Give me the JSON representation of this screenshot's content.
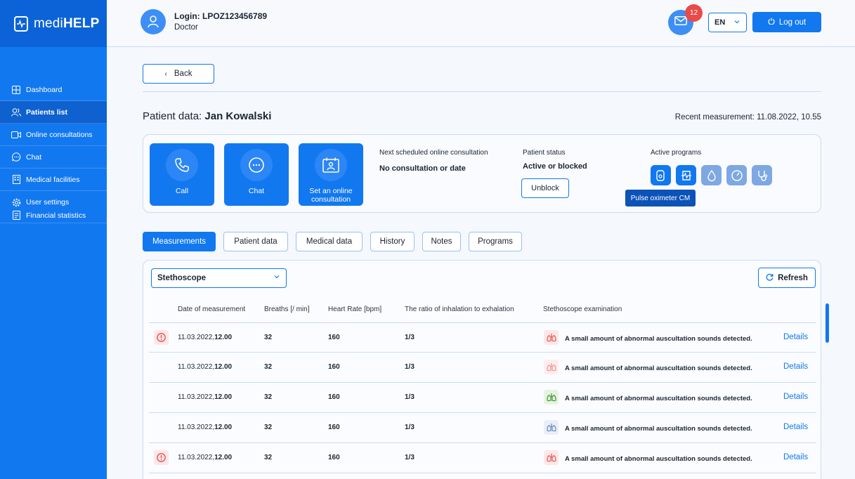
{
  "brand": {
    "name_prefix": "medi",
    "name_bold": "HELP"
  },
  "sidebar": {
    "items": [
      {
        "label": "Dashboard",
        "icon": "dashboard-icon"
      },
      {
        "label": "Patients list",
        "icon": "users-icon"
      },
      {
        "label": "Online consultations",
        "icon": "video-icon"
      },
      {
        "label": "Chat",
        "icon": "chat-icon"
      },
      {
        "label": "Medical facilities",
        "icon": "building-icon"
      },
      {
        "label": "User settings",
        "icon": "gear-icon"
      },
      {
        "label": "Financial statistics",
        "icon": "document-icon"
      }
    ]
  },
  "header": {
    "login": "Login: LPOZ123456789",
    "role": "Doctor",
    "mail_count": "12",
    "language": "EN",
    "logout_label": "Log out"
  },
  "main": {
    "back_label": "Back",
    "patient_data_label": "Patient data:",
    "patient_name": "Jan Kowalski",
    "recent_measurement": "Recent measurement: 11.08.2022, 10.55",
    "actions": {
      "call": "Call",
      "chat": "Chat",
      "consult_line1": "Set an online",
      "consult_line2": "consultation"
    },
    "next_consultation": {
      "heading": "Next scheduled online consultation",
      "value": "No consultation or date"
    },
    "status": {
      "heading": "Patient status",
      "value": "Active or blocked",
      "unblock_label": "Unblock"
    },
    "programs": {
      "heading": "Active programs",
      "tooltip": "Pulse oximeter CM"
    },
    "tabs": [
      "Measurements",
      "Patient data",
      "Medical data",
      "History",
      "Notes",
      "Programs"
    ],
    "select_value": "Stethoscope",
    "refresh_label": "Refresh",
    "table": {
      "headers": [
        "Date of measurement",
        "Breaths [/ min]",
        "Heart Rate [bpm]",
        "The ratio of inhalation to exhalation",
        "Stethoscope examination"
      ],
      "rows": [
        {
          "date": "11.03.2022,",
          "time": "12.00",
          "breaths": "32",
          "hr": "160",
          "ratio": "1/3",
          "exam": "A small amount of abnormal auscultation sounds detected.",
          "details": "Details"
        },
        {
          "date": "11.03.2022,",
          "time": "12.00",
          "breaths": "32",
          "hr": "160",
          "ratio": "1/3",
          "exam": "A small amount of abnormal auscultation sounds detected.",
          "details": "Details"
        },
        {
          "date": "11.03.2022,",
          "time": "12.00",
          "breaths": "32",
          "hr": "160",
          "ratio": "1/3",
          "exam": "A small amount of abnormal auscultation sounds detected.",
          "details": "Details"
        },
        {
          "date": "11.03.2022,",
          "time": "12.00",
          "breaths": "32",
          "hr": "160",
          "ratio": "1/3",
          "exam": "A small amount of abnormal auscultation sounds detected.",
          "details": "Details"
        },
        {
          "date": "11.03.2022,",
          "time": "12.00",
          "breaths": "32",
          "hr": "160",
          "ratio": "1/3",
          "exam": "A small amount of abnormal auscultation sounds detected.",
          "details": "Details"
        }
      ]
    }
  },
  "colors": {
    "primary": "#1278f0",
    "alert": "#e94a4a",
    "lung_red": "#e8605c",
    "lung_green": "#4a9a3c",
    "lung_blue": "#6f8fc0"
  }
}
